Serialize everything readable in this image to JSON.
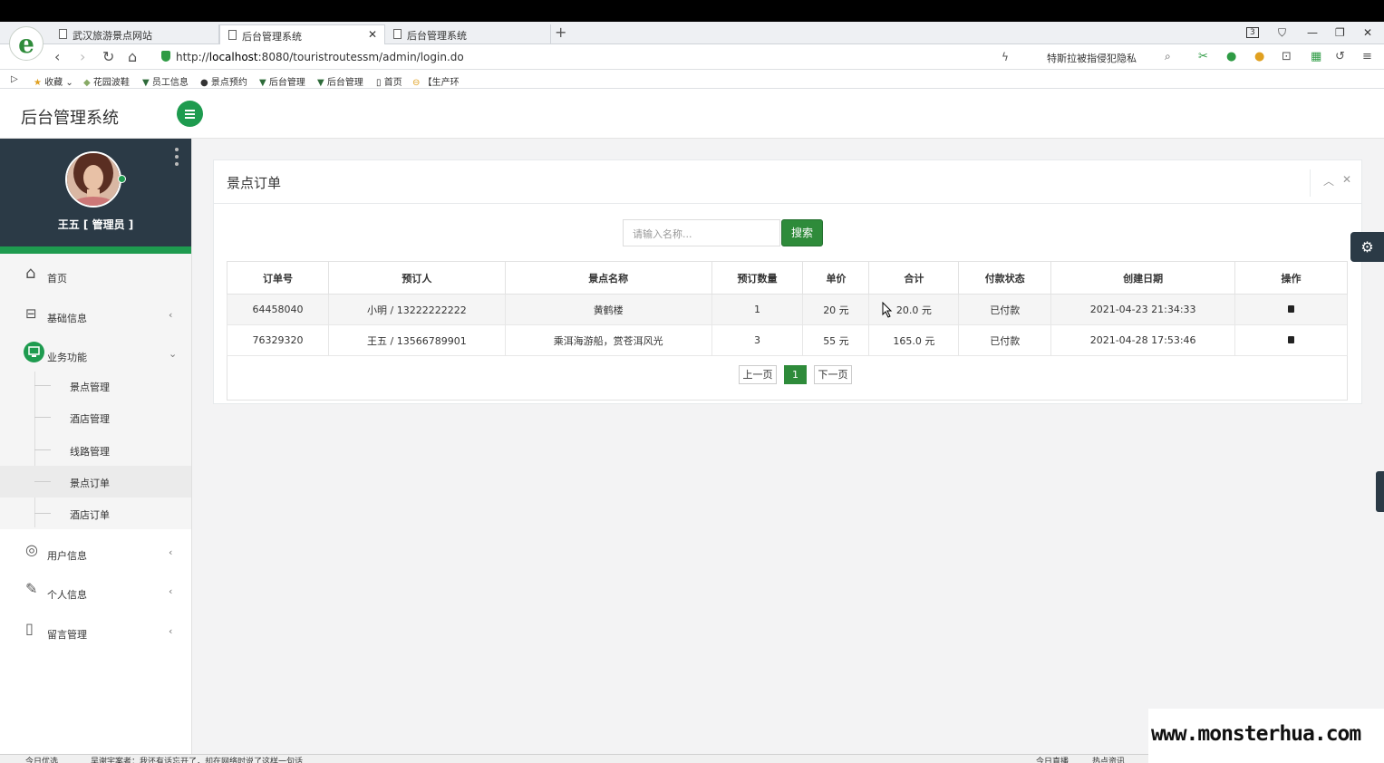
{
  "browser": {
    "tabs": [
      {
        "label": "武汉旅游景点网站",
        "active": false
      },
      {
        "label": "后台管理系统",
        "active": true
      },
      {
        "label": "后台管理系统",
        "active": false
      }
    ],
    "url_prefix": "http://",
    "url_host": "localhost",
    "url_rest": ":8080/touristroutessm/admin/login.do",
    "search_hint": "特斯拉被指侵犯隐私",
    "tab_counter": "3",
    "bookmarks": [
      "收藏",
      "花园波鞋",
      "员工信息",
      "景点预约",
      "后台管理",
      "后台管理",
      "首页",
      "【生产环"
    ]
  },
  "app": {
    "brand": "后台管理系统",
    "user": "王五 [ 管理员 ]",
    "accent": "#1e9b4f",
    "dark": "#2b3a46"
  },
  "sidebar": {
    "items": [
      {
        "label": "首页",
        "icon": "home-icon"
      },
      {
        "label": "基础信息",
        "icon": "briefcase-icon"
      },
      {
        "label": "业务功能",
        "icon": "monitor-icon"
      },
      {
        "label": "用户信息",
        "icon": "user-icon"
      },
      {
        "label": "个人信息",
        "icon": "edit-icon"
      },
      {
        "label": "留言管理",
        "icon": "bookmark-icon"
      }
    ],
    "sub_items": [
      "景点管理",
      "酒店管理",
      "线路管理",
      "景点订单",
      "酒店订单"
    ]
  },
  "panel": {
    "title": "景点订单",
    "search_placeholder": "请输入名称...",
    "search_button": "搜索"
  },
  "table": {
    "headers": [
      "订单号",
      "预订人",
      "景点名称",
      "预订数量",
      "单价",
      "合计",
      "付款状态",
      "创建日期",
      "操作"
    ],
    "rows": [
      [
        "64458040",
        "小明 / 13222222222",
        "黄鹤楼",
        "1",
        "20 元",
        "20.0 元",
        "已付款",
        "2021-04-23 21:34:33"
      ],
      [
        "76329320",
        "王五 / 13566789901",
        "乘洱海游船，赏苍洱风光",
        "3",
        "55 元",
        "165.0 元",
        "已付款",
        "2021-04-28 17:53:46"
      ]
    ]
  },
  "pagination": {
    "prev": "上一页",
    "current": "1",
    "next": "下一页"
  },
  "statusbar": {
    "left": "今日优选",
    "news": "吴谢宇案者：我还有话忘开了，却在网络时说了这样一句话",
    "right1": "今日直播",
    "right2": "热点资讯"
  },
  "watermark": "www.monsterhua.com"
}
